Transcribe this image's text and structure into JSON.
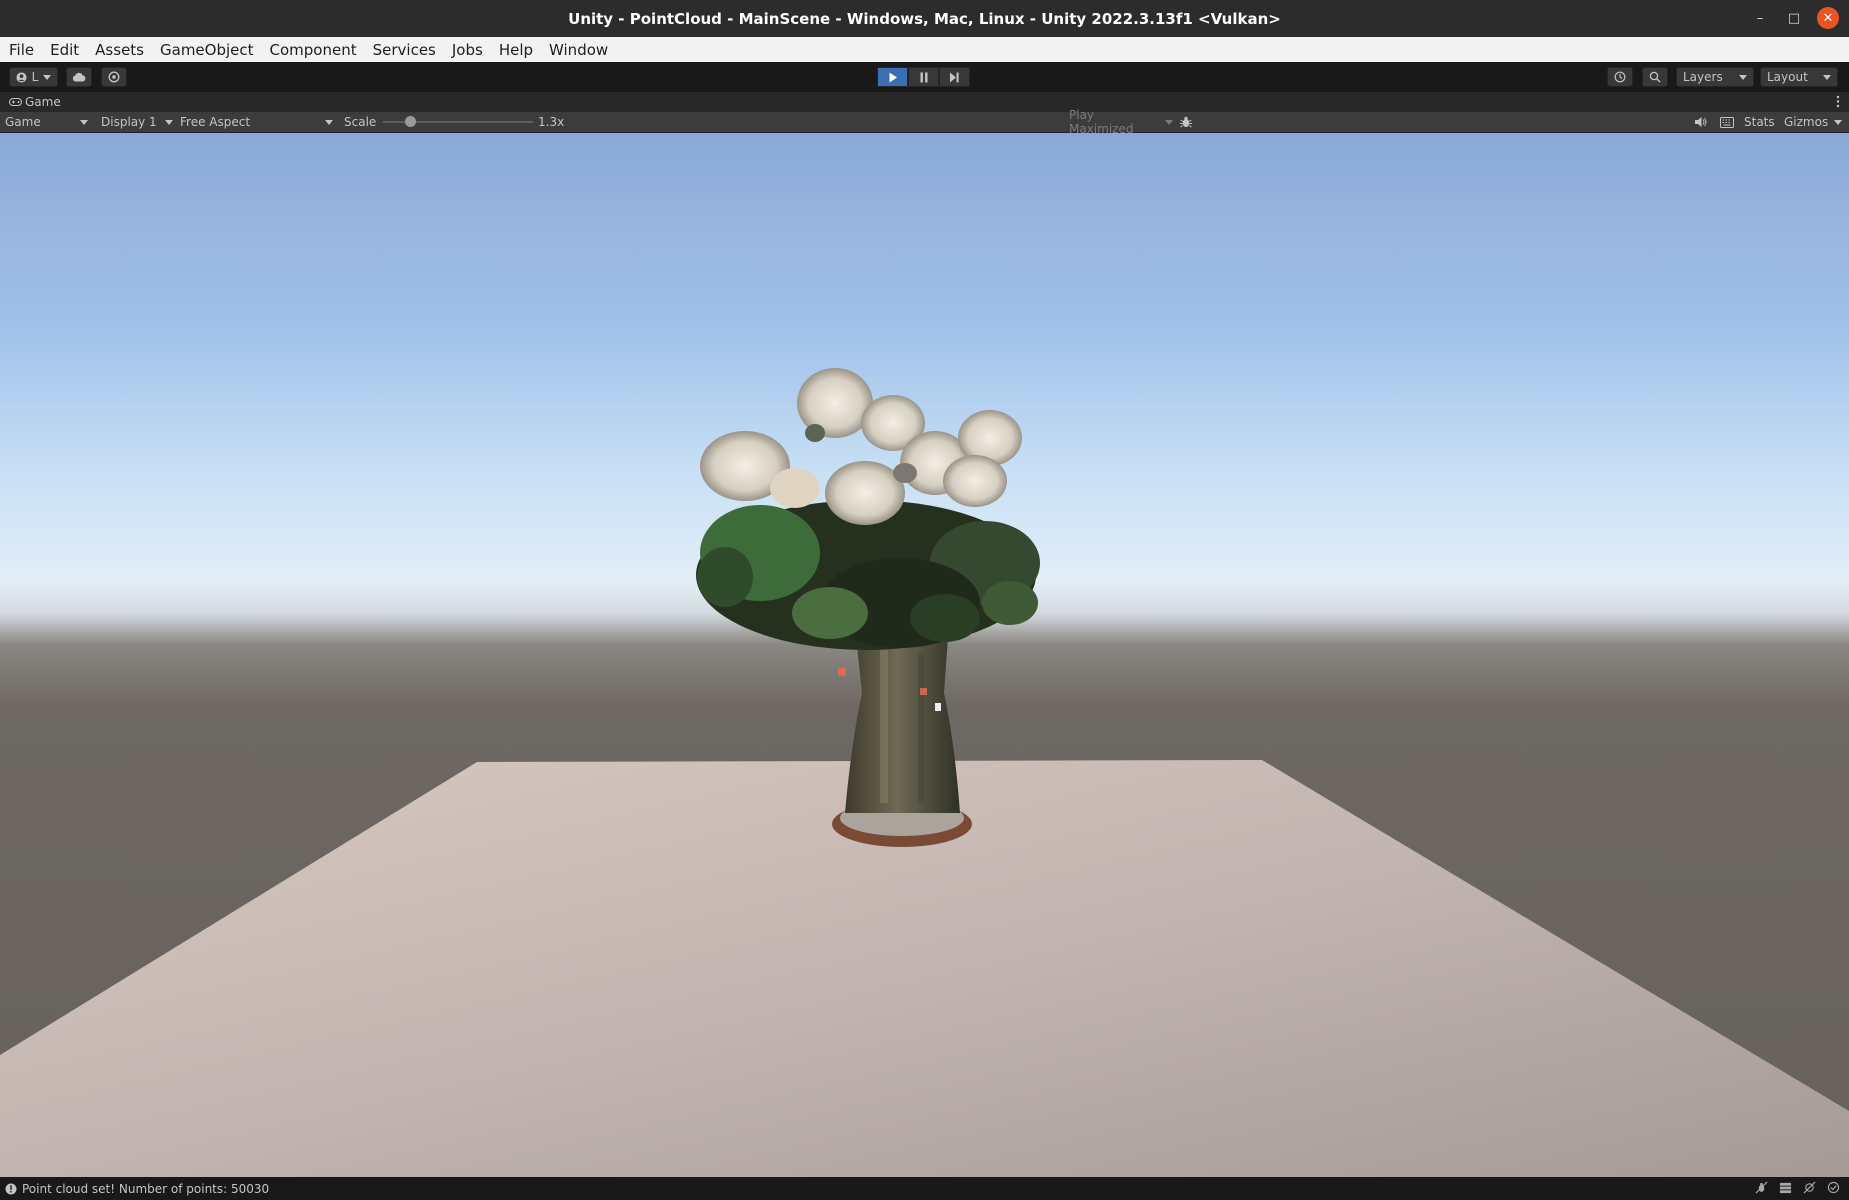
{
  "window": {
    "title": "Unity - PointCloud - MainScene - Windows, Mac, Linux - Unity 2022.3.13f1 <Vulkan>",
    "minimize_icon": "minimize-icon",
    "maximize_icon": "restore-icon",
    "close_icon": "close-icon"
  },
  "menu": [
    "File",
    "Edit",
    "Assets",
    "GameObject",
    "Component",
    "Services",
    "Jobs",
    "Help",
    "Window"
  ],
  "toolbar": {
    "account_label": "L",
    "layers_label": "Layers",
    "layout_label": "Layout",
    "play_state": "playing"
  },
  "tab": {
    "label": "Game",
    "icon": "gamepad-icon"
  },
  "game_toolbar": {
    "view_mode": "Game",
    "display": "Display 1",
    "aspect": "Free Aspect",
    "scale_label": "Scale",
    "scale_value": "1.3x",
    "scale_fraction": 0.16,
    "play_maximized": "Play Maximized",
    "stats_label": "Stats",
    "gizmos_label": "Gizmos"
  },
  "viewport": {
    "sky_top": "#8ba9d6",
    "horizon": "#e3eef8",
    "ground": "#66615d",
    "plane": "#c9b9b3",
    "subject": "point cloud of white hydrangeas in a glass vase"
  },
  "status": {
    "message": "Point cloud set! Number of points: 50030",
    "icon": "info-icon"
  },
  "colors": {
    "accent_play": "#3b6fb1",
    "close_button": "#e95420",
    "toolbar_bg": "#191919"
  }
}
